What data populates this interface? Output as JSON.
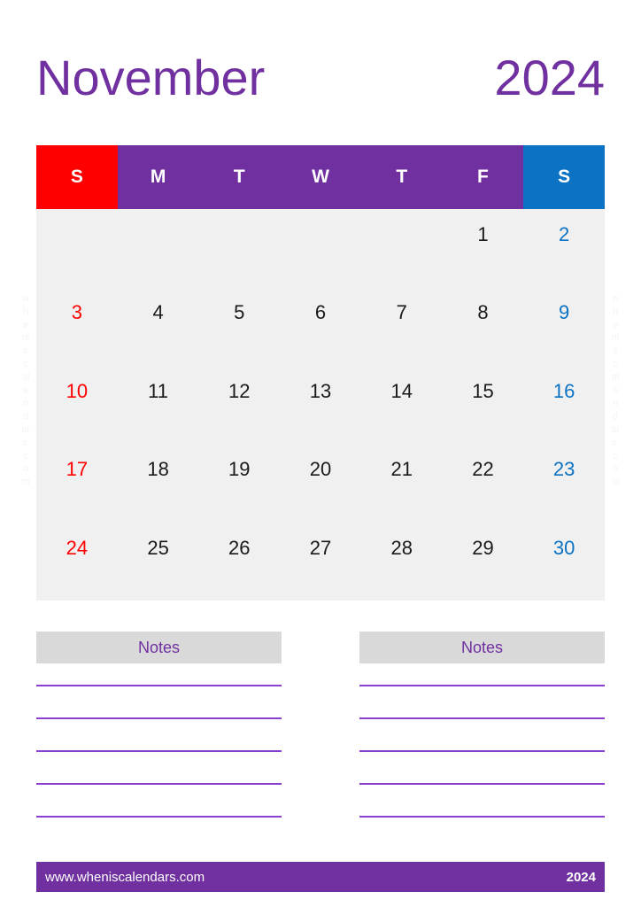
{
  "title": {
    "month": "November",
    "year": "2024",
    "color": "#7030A0"
  },
  "colors": {
    "purple": "#7030A0",
    "sunday_red": "#FF0000",
    "saturday_blue": "#0B72C4",
    "grid_background": "#F0F0F0",
    "notes_header_background": "#D9D9D9",
    "notes_line": "#8A3FD1",
    "weekday_text": "#1A1A1A"
  },
  "calendar": {
    "weekday_headers": [
      {
        "label": "S",
        "kind": "sun"
      },
      {
        "label": "M",
        "kind": "weekday"
      },
      {
        "label": "T",
        "kind": "weekday"
      },
      {
        "label": "W",
        "kind": "weekday"
      },
      {
        "label": "T",
        "kind": "weekday"
      },
      {
        "label": "F",
        "kind": "weekday"
      },
      {
        "label": "S",
        "kind": "sat"
      }
    ],
    "weeks": [
      [
        "",
        "",
        "",
        "",
        "",
        "1",
        "2"
      ],
      [
        "3",
        "4",
        "5",
        "6",
        "7",
        "8",
        "9"
      ],
      [
        "10",
        "11",
        "12",
        "13",
        "14",
        "15",
        "16"
      ],
      [
        "17",
        "18",
        "19",
        "20",
        "21",
        "22",
        "23"
      ],
      [
        "24",
        "25",
        "26",
        "27",
        "28",
        "29",
        "30"
      ]
    ]
  },
  "watermark": {
    "text": "wheniscalendars.com",
    "lines": [
      "w",
      "h",
      "e",
      "ni",
      "s",
      "c",
      "al",
      "e",
      "n",
      "d",
      "ar",
      "s.",
      "c",
      "o",
      "m"
    ]
  },
  "notes": {
    "left_label": "Notes",
    "right_label": "Notes",
    "line_count": 5
  },
  "footer": {
    "website": "www.wheniscalendars.com",
    "year": "2024"
  }
}
